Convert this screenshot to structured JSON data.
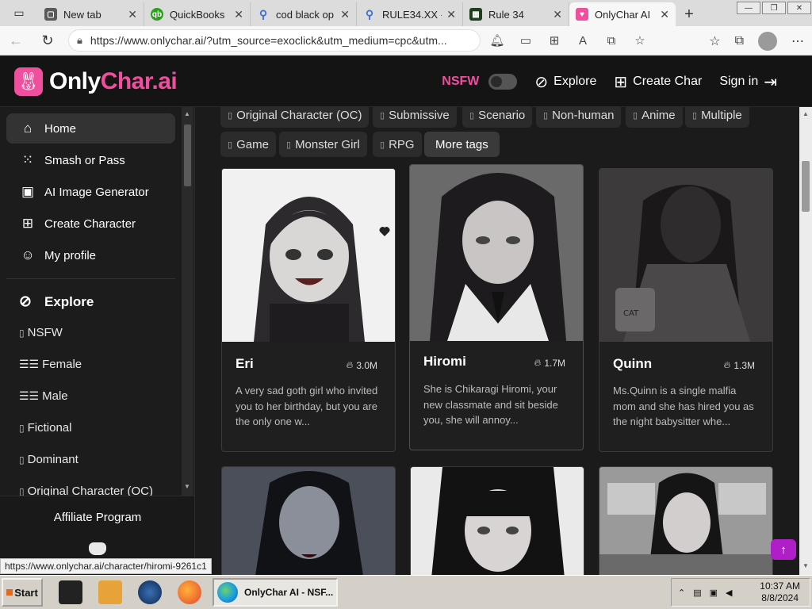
{
  "browser": {
    "tabs": [
      {
        "label": "New tab",
        "favicon": "newtab-icon",
        "color": "#5a5a5a"
      },
      {
        "label": "QuickBooks",
        "favicon": "quickbooks-icon",
        "color": "#2ca01c"
      },
      {
        "label": "cod black op",
        "favicon": "search-icon",
        "color": "#3a6fd8"
      },
      {
        "label": "RULE34.XX -",
        "favicon": "search-icon",
        "color": "#3a6fd8"
      },
      {
        "label": "Rule 34",
        "favicon": "rule34-icon",
        "color": "#1d3f1d"
      },
      {
        "label": "OnlyChar AI",
        "favicon": "onlychar-icon",
        "color": "#f04f9d",
        "active": true
      }
    ],
    "url": "https://www.onlychar.ai/?utm_source=exoclick&utm_medium=cpc&utm..."
  },
  "site": {
    "brand_prefix": "Only",
    "brand_accent": "Char.ai",
    "brand_color": "#f04f9d",
    "header": {
      "nsfw_label": "NSFW",
      "explore_label": "Explore",
      "create_label": "Create Char",
      "signin_label": "Sign in"
    }
  },
  "sidebar": {
    "items": [
      {
        "label": "Home",
        "icon": "home-icon",
        "active": true
      },
      {
        "label": "Smash or Pass",
        "icon": "grid-icon"
      },
      {
        "label": "AI Image Generator",
        "icon": "image-icon"
      },
      {
        "label": "Create Character",
        "icon": "plus-square-icon"
      },
      {
        "label": "My profile",
        "icon": "user-icon"
      }
    ],
    "explore_heading": "Explore",
    "explore_items": [
      {
        "label": "NSFW",
        "icon": "tag-icon"
      },
      {
        "label": "Female",
        "icon": "flag-icon"
      },
      {
        "label": "Male",
        "icon": "flag-icon"
      },
      {
        "label": "Fictional",
        "icon": "tag-icon"
      },
      {
        "label": "Dominant",
        "icon": "tag-icon"
      },
      {
        "label": "Original Character (OC)",
        "icon": "tag-icon"
      }
    ],
    "affiliate_label": "Affiliate Program"
  },
  "tags": {
    "row1": [
      "Original Character (OC)",
      "Submissive",
      "Scenario",
      "Non-human",
      "Anime",
      "Multiple"
    ],
    "row2": [
      "Game",
      "Monster Girl",
      "RPG"
    ],
    "more_label": "More tags"
  },
  "cards": [
    {
      "name": "Eri",
      "views": "3.0M",
      "description": "A very sad goth girl who invited you to her birthday, but you are the only one w..."
    },
    {
      "name": "Hiromi",
      "views": "1.7M",
      "description": "She is Chikaragi Hiromi, your new classmate and sit beside you, she will annoy..."
    },
    {
      "name": "Quinn",
      "views": "1.3M",
      "description": "Ms.Quinn is a single malfia mom and she has hired you as the night babysitter whe..."
    }
  ],
  "status_url": "https://www.onlychar.ai/character/hiromi-9261c1",
  "taskbar": {
    "start_label": "Start",
    "active_window": "OnlyChar AI - NSF...",
    "time": "10:37 AM",
    "date": "8/8/2024"
  }
}
